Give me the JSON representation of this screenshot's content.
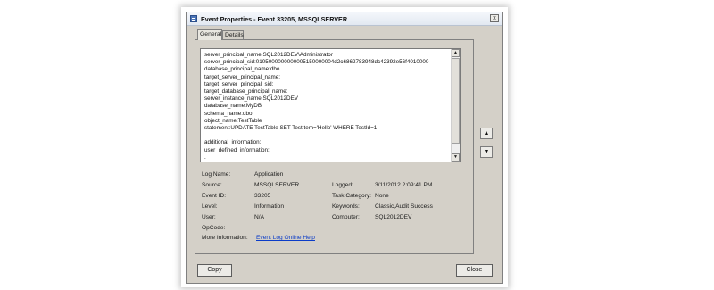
{
  "window": {
    "title": "Event Properties - Event 33205, MSSQLSERVER",
    "close_glyph": "x"
  },
  "tabs": [
    {
      "label": "General"
    },
    {
      "label": "Details"
    }
  ],
  "event_text": [
    "server_principal_name:SQL2012DEV\\Administrator",
    "server_principal_sid:0105000000000005150000004d2c6862783948dc42392e56f4010000",
    "database_principal_name:dbo",
    "target_server_principal_name:",
    "target_server_principal_sid:",
    "target_database_principal_name:",
    "server_instance_name:SQL2012DEV",
    "database_name:MyDB",
    "schema_name:dbo",
    "object_name:TestTable",
    "statement:UPDATE TestTable SET TestItem='Hello' WHERE TestId=1",
    "",
    "additional_information:",
    "user_defined_information:",
    "."
  ],
  "fields": {
    "log_name_label": "Log Name:",
    "log_name_value": "Application",
    "source_label": "Source:",
    "source_value": "MSSQLSERVER",
    "logged_label": "Logged:",
    "logged_value": "3/11/2012 2:09:41 PM",
    "event_id_label": "Event ID:",
    "event_id_value": "33205",
    "task_category_label": "Task Category:",
    "task_category_value": "None",
    "level_label": "Level:",
    "level_value": "Information",
    "keywords_label": "Keywords:",
    "keywords_value": "Classic,Audit Success",
    "user_label": "User:",
    "user_value": "N/A",
    "computer_label": "Computer:",
    "computer_value": "SQL2012DEV",
    "opcode_label": "OpCode:",
    "more_info_label": "More Information:",
    "more_info_link": "Event Log Online Help"
  },
  "nav": {
    "up_glyph": "▲",
    "down_glyph": "▼"
  },
  "buttons": {
    "copy": "Copy",
    "close": "Close"
  }
}
